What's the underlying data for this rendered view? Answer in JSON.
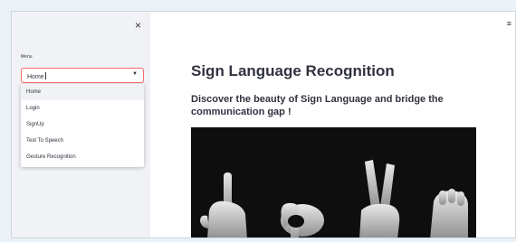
{
  "sidebar": {
    "menu_label": "Menu",
    "selected_value": "Home",
    "options": [
      "Home",
      "Login",
      "SignUp",
      "Text To Speech",
      "Gesture Recognition"
    ]
  },
  "main": {
    "title": "Sign Language Recognition",
    "subtitle": "Discover the beauty of Sign Language and bridge the communication gap !"
  },
  "icons": {
    "close": "close-icon",
    "hamburger": "hamburger-menu-icon",
    "dropdown": "chevron-down-icon"
  },
  "colors": {
    "accent": "#f36b6b",
    "sidebar_bg": "#f0f2f6",
    "text": "#31333f"
  }
}
